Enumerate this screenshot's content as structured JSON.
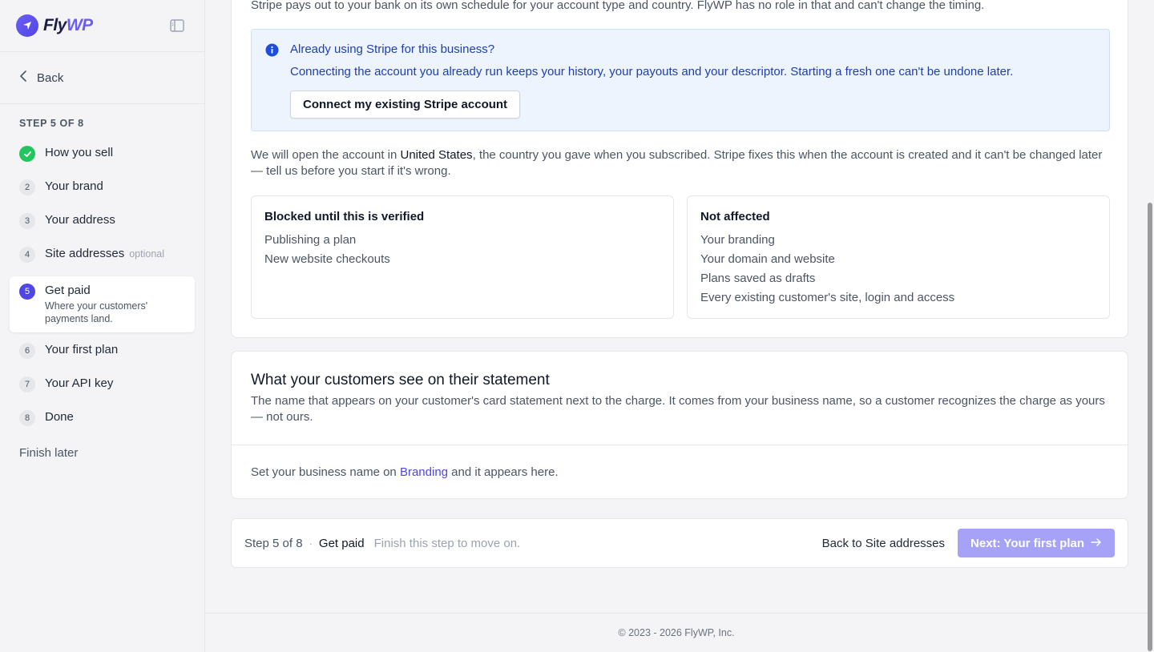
{
  "brand": {
    "name_part1": "Fly",
    "name_part2": "WP"
  },
  "sidebar": {
    "back_label": "Back",
    "step_counter": "STEP 5 OF 8",
    "steps": [
      {
        "num": "",
        "label": "How you sell",
        "state": "done"
      },
      {
        "num": "2",
        "label": "Your brand"
      },
      {
        "num": "3",
        "label": "Your address"
      },
      {
        "num": "4",
        "label": "Site addresses",
        "tag": "optional"
      },
      {
        "num": "5",
        "label": "Get paid",
        "sub": "Where your customers' payments land.",
        "state": "active"
      },
      {
        "num": "6",
        "label": "Your first plan"
      },
      {
        "num": "7",
        "label": "Your API key"
      },
      {
        "num": "8",
        "label": "Done"
      }
    ],
    "finish_later": "Finish later"
  },
  "payout": {
    "note": "Stripe pays out to your bank on its own schedule for your account type and country. FlyWP has no role in that and can't change the timing."
  },
  "info_box": {
    "title": "Already using Stripe for this business?",
    "body": "Connecting the account you already run keeps your history, your payouts and your descriptor. Starting a fresh one can't be undone later.",
    "button": "Connect my existing Stripe account"
  },
  "country": {
    "before": "We will open the account in ",
    "name": "United States",
    "after": ", the country you gave when you subscribed. Stripe fixes this when the account is created and it can't be changed later — tell us before you start if it's wrong."
  },
  "blocked": {
    "title": "Blocked until this is verified",
    "items": [
      "Publishing a plan",
      "New website checkouts"
    ]
  },
  "not_affected": {
    "title": "Not affected",
    "items": [
      "Your branding",
      "Your domain and website",
      "Plans saved as drafts",
      "Every existing customer's site, login and access"
    ]
  },
  "statement": {
    "title": "What your customers see on their statement",
    "body": "The name that appears on your customer's card statement next to the charge. It comes from your business name, so a customer recognizes the charge as yours — not ours.",
    "empty_before": "Set your business name on ",
    "empty_link": "Branding",
    "empty_after": " and it appears here."
  },
  "footer_bar": {
    "step": "Step 5 of 8",
    "dot": "·",
    "name": "Get paid",
    "hint": "Finish this step to move on.",
    "back": "Back to Site addresses",
    "next": "Next: Your first plan"
  },
  "page_footer": "© 2023 - 2026 FlyWP, Inc.",
  "colors": {
    "accent": "#4f46e5",
    "success": "#22c55e",
    "info_bg": "#eef4fe",
    "info_text": "#1e40af",
    "next_disabled": "#a5a2f7"
  }
}
